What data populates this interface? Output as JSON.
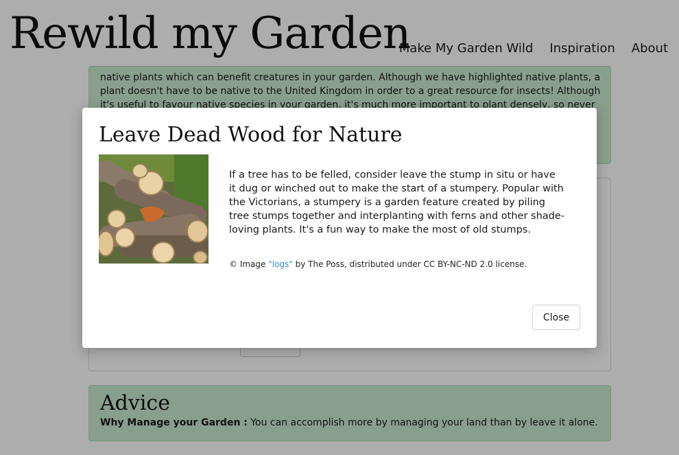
{
  "header": {
    "logo": "Rewild my Garden",
    "nav": [
      "Make My Garden Wild",
      "Inspiration",
      "About"
    ]
  },
  "background": {
    "top_card_text": "native plants which can benefit creatures in your garden. Although we have highlighted native plants, a plant doesn't have to be native to the United Kingdom in order to a great resource for insects! Although it's useful to favour native species in your garden, it's much more important to plant densely, so never",
    "advice": {
      "title": "Advice",
      "label": "Why Manage your Garden :",
      "text": " You can accomplish more by managing your land than by leave it alone."
    }
  },
  "modal": {
    "title": "Leave Dead Wood for Nature",
    "image_alt": "logs",
    "body": "If a tree has to be felled, consider leave the stump in situ or have it dug or winched out to make the start of a stumpery. Popular with the Victorians, a stumpery is a garden feature created by piling tree stumps together and interplanting with ferns and other shade-loving plants. It's a fun way to make the most of old stumps.",
    "credit": {
      "prefix": "© Image ",
      "link": "\"logs\"",
      "suffix": " by The Poss, distributed under CC BY-NC-ND 2.0 license."
    },
    "close_label": "Close"
  },
  "colors": {
    "card_green": "#c9ead1",
    "link_blue": "#2f8bd6",
    "backdrop": "rgba(0,0,0,0.32)"
  }
}
